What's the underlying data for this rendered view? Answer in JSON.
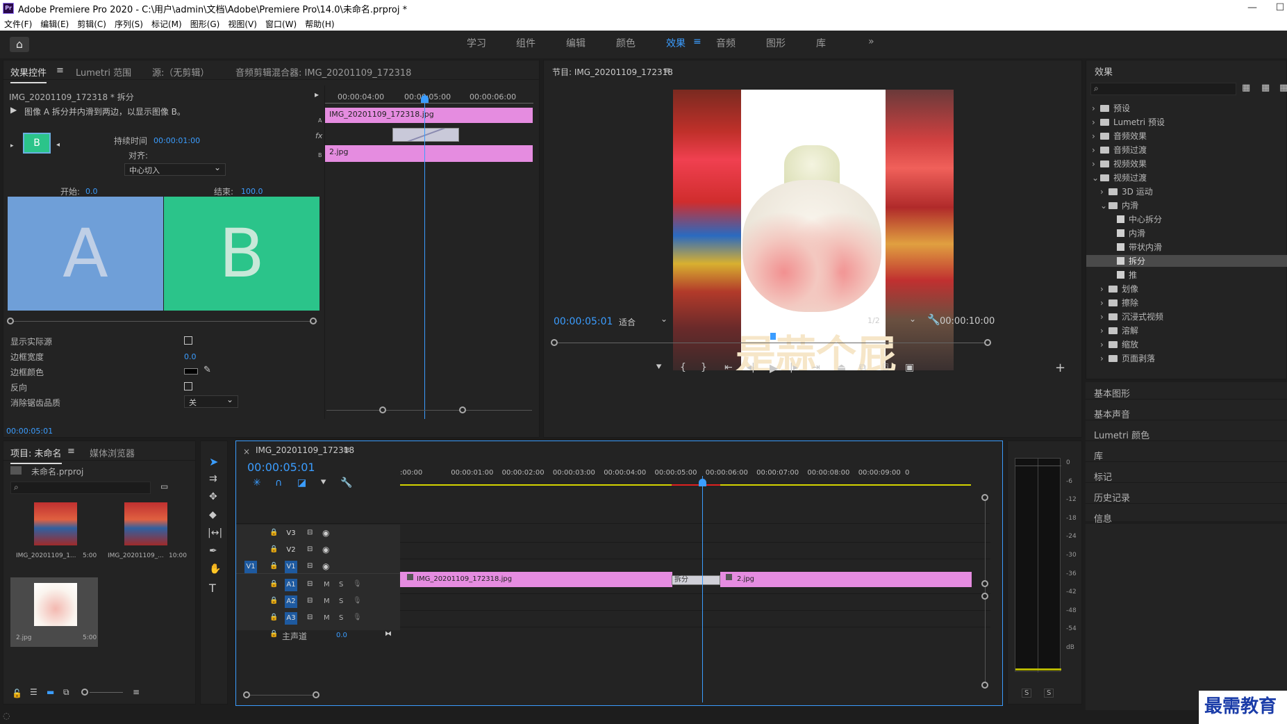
{
  "window": {
    "title": "Adobe Premiere Pro 2020 - C:\\用户\\admin\\文档\\Adobe\\Premiere Pro\\14.0\\未命名.prproj *",
    "logo": "Pr",
    "minimize": "—",
    "maximize": "☐"
  },
  "menu": [
    "文件(F)",
    "编辑(E)",
    "剪辑(C)",
    "序列(S)",
    "标记(M)",
    "图形(G)",
    "视图(V)",
    "窗口(W)",
    "帮助(H)"
  ],
  "workspaces": {
    "items": [
      "学习",
      "组件",
      "编辑",
      "颜色",
      "效果",
      "音频",
      "图形",
      "库"
    ],
    "active": "效果",
    "more": "»"
  },
  "effect_controls": {
    "tabs": [
      "效果控件",
      "Lumetri 范围",
      "源:（无剪辑）",
      "音频剪辑混合器: IMG_20201109_172318"
    ],
    "clip_title": "IMG_20201109_172318 * 拆分",
    "description": "图像 A 拆分并内滑到两边，以显示图像 B。",
    "duration_label": "持续时间",
    "duration_value": "00:00:01:00",
    "align_label": "对齐:",
    "align_value": "中心切入",
    "start_label": "开始:",
    "start_value": "0.0",
    "end_label": "结束:",
    "end_value": "100.0",
    "preview_a": "A",
    "preview_b": "B",
    "thumb_label": "B",
    "props": [
      {
        "label": "显示实际源",
        "type": "checkbox"
      },
      {
        "label": "边框宽度",
        "type": "value",
        "value": "0.0"
      },
      {
        "label": "边框颜色",
        "type": "color"
      },
      {
        "label": "反向",
        "type": "checkbox"
      },
      {
        "label": "消除锯齿品质",
        "type": "select",
        "value": "关"
      }
    ],
    "timecode": "00:00:05:01",
    "mini_ruler": [
      "00:00:04:00",
      "00:00:05:00",
      "00:00:06:00"
    ],
    "mini_clip_a": "IMG_20201109_172318.jpg",
    "mini_clip_b": "2.jpg",
    "track_a": "A",
    "track_b": "B",
    "fx_label": "fx"
  },
  "program": {
    "title": "节目: IMG_20201109_172318",
    "timecode": "00:00:05:01",
    "fit": "适合",
    "quality": "1/2",
    "duration": "00:00:10:00",
    "watermark_text": "是蒜个屁"
  },
  "effects_panel": {
    "title": "效果",
    "tree": [
      {
        "label": "预设",
        "level": 0,
        "kind": "folder",
        "expanded": false
      },
      {
        "label": "Lumetri 预设",
        "level": 0,
        "kind": "folder",
        "expanded": false
      },
      {
        "label": "音频效果",
        "level": 0,
        "kind": "folder",
        "expanded": false
      },
      {
        "label": "音频过渡",
        "level": 0,
        "kind": "folder",
        "expanded": false
      },
      {
        "label": "视频效果",
        "level": 0,
        "kind": "folder",
        "expanded": false
      },
      {
        "label": "视频过渡",
        "level": 0,
        "kind": "folder",
        "expanded": true
      },
      {
        "label": "3D 运动",
        "level": 1,
        "kind": "folder",
        "expanded": false
      },
      {
        "label": "内滑",
        "level": 1,
        "kind": "folder",
        "expanded": true
      },
      {
        "label": "中心拆分",
        "level": 2,
        "kind": "fx"
      },
      {
        "label": "内滑",
        "level": 2,
        "kind": "fx"
      },
      {
        "label": "带状内滑",
        "level": 2,
        "kind": "fx"
      },
      {
        "label": "拆分",
        "level": 2,
        "kind": "fx",
        "selected": true
      },
      {
        "label": "推",
        "level": 2,
        "kind": "fx"
      },
      {
        "label": "划像",
        "level": 1,
        "kind": "folder",
        "expanded": false
      },
      {
        "label": "擦除",
        "level": 1,
        "kind": "folder",
        "expanded": false
      },
      {
        "label": "沉浸式视频",
        "level": 1,
        "kind": "folder",
        "expanded": false
      },
      {
        "label": "溶解",
        "level": 1,
        "kind": "folder",
        "expanded": false
      },
      {
        "label": "缩放",
        "level": 1,
        "kind": "folder",
        "expanded": false
      },
      {
        "label": "页面剥落",
        "level": 1,
        "kind": "folder",
        "expanded": false
      }
    ],
    "side_panels": [
      "基本图形",
      "基本声音",
      "Lumetri 颜色",
      "库",
      "标记",
      "历史记录",
      "信息"
    ]
  },
  "project": {
    "tabs": [
      "项目: 未命名",
      "媒体浏览器"
    ],
    "file": "未命名.prproj",
    "items": [
      {
        "name": "IMG_20201109_1...",
        "duration": "5:00"
      },
      {
        "name": "IMG_20201109_...",
        "duration": "10:00"
      },
      {
        "name": "2.jpg",
        "duration": "5:00"
      }
    ]
  },
  "timeline": {
    "tab": "IMG_20201109_172318",
    "close": "×",
    "timecode": "00:00:05:01",
    "ruler": [
      ":00:00",
      "00:00:01:00",
      "00:00:02:00",
      "00:00:03:00",
      "00:00:04:00",
      "00:00:05:00",
      "00:00:06:00",
      "00:00:07:00",
      "00:00:08:00",
      "00:00:09:00",
      "0"
    ],
    "video_tracks": [
      "V3",
      "V2",
      "V1"
    ],
    "audio_tracks": [
      "A1",
      "A2",
      "A3"
    ],
    "source_v": "V1",
    "master_label": "主声道",
    "master_value": "0.0",
    "mute": "M",
    "solo": "S",
    "clip_a": "IMG_20201109_172318.jpg",
    "transition": "拆分",
    "clip_b": "2.jpg"
  },
  "meter": {
    "scale": [
      "0",
      "-6",
      "-12",
      "-18",
      "-24",
      "-30",
      "-36",
      "-42",
      "-48",
      "-54",
      "dB"
    ],
    "solo_left": "S",
    "solo_right": "S"
  },
  "watermark": "最需教育",
  "colors": {
    "accent": "#3b9dff",
    "clip": "#e58ce0",
    "panel": "#232323"
  }
}
